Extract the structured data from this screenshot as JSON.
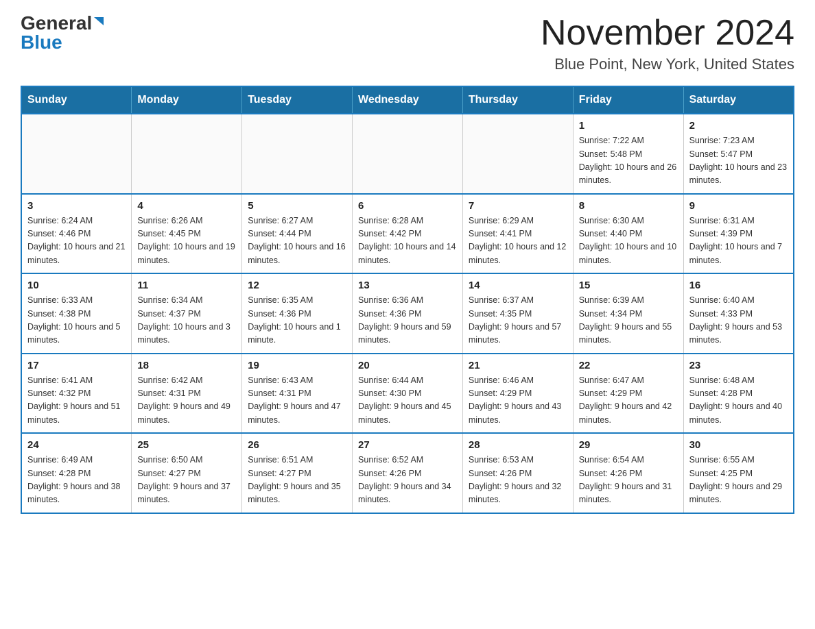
{
  "header": {
    "logo_general": "General",
    "logo_blue": "Blue",
    "title": "November 2024",
    "subtitle": "Blue Point, New York, United States"
  },
  "weekdays": [
    "Sunday",
    "Monday",
    "Tuesday",
    "Wednesday",
    "Thursday",
    "Friday",
    "Saturday"
  ],
  "weeks": [
    [
      {
        "day": "",
        "info": ""
      },
      {
        "day": "",
        "info": ""
      },
      {
        "day": "",
        "info": ""
      },
      {
        "day": "",
        "info": ""
      },
      {
        "day": "",
        "info": ""
      },
      {
        "day": "1",
        "info": "Sunrise: 7:22 AM\nSunset: 5:48 PM\nDaylight: 10 hours and 26 minutes."
      },
      {
        "day": "2",
        "info": "Sunrise: 7:23 AM\nSunset: 5:47 PM\nDaylight: 10 hours and 23 minutes."
      }
    ],
    [
      {
        "day": "3",
        "info": "Sunrise: 6:24 AM\nSunset: 4:46 PM\nDaylight: 10 hours and 21 minutes."
      },
      {
        "day": "4",
        "info": "Sunrise: 6:26 AM\nSunset: 4:45 PM\nDaylight: 10 hours and 19 minutes."
      },
      {
        "day": "5",
        "info": "Sunrise: 6:27 AM\nSunset: 4:44 PM\nDaylight: 10 hours and 16 minutes."
      },
      {
        "day": "6",
        "info": "Sunrise: 6:28 AM\nSunset: 4:42 PM\nDaylight: 10 hours and 14 minutes."
      },
      {
        "day": "7",
        "info": "Sunrise: 6:29 AM\nSunset: 4:41 PM\nDaylight: 10 hours and 12 minutes."
      },
      {
        "day": "8",
        "info": "Sunrise: 6:30 AM\nSunset: 4:40 PM\nDaylight: 10 hours and 10 minutes."
      },
      {
        "day": "9",
        "info": "Sunrise: 6:31 AM\nSunset: 4:39 PM\nDaylight: 10 hours and 7 minutes."
      }
    ],
    [
      {
        "day": "10",
        "info": "Sunrise: 6:33 AM\nSunset: 4:38 PM\nDaylight: 10 hours and 5 minutes."
      },
      {
        "day": "11",
        "info": "Sunrise: 6:34 AM\nSunset: 4:37 PM\nDaylight: 10 hours and 3 minutes."
      },
      {
        "day": "12",
        "info": "Sunrise: 6:35 AM\nSunset: 4:36 PM\nDaylight: 10 hours and 1 minute."
      },
      {
        "day": "13",
        "info": "Sunrise: 6:36 AM\nSunset: 4:36 PM\nDaylight: 9 hours and 59 minutes."
      },
      {
        "day": "14",
        "info": "Sunrise: 6:37 AM\nSunset: 4:35 PM\nDaylight: 9 hours and 57 minutes."
      },
      {
        "day": "15",
        "info": "Sunrise: 6:39 AM\nSunset: 4:34 PM\nDaylight: 9 hours and 55 minutes."
      },
      {
        "day": "16",
        "info": "Sunrise: 6:40 AM\nSunset: 4:33 PM\nDaylight: 9 hours and 53 minutes."
      }
    ],
    [
      {
        "day": "17",
        "info": "Sunrise: 6:41 AM\nSunset: 4:32 PM\nDaylight: 9 hours and 51 minutes."
      },
      {
        "day": "18",
        "info": "Sunrise: 6:42 AM\nSunset: 4:31 PM\nDaylight: 9 hours and 49 minutes."
      },
      {
        "day": "19",
        "info": "Sunrise: 6:43 AM\nSunset: 4:31 PM\nDaylight: 9 hours and 47 minutes."
      },
      {
        "day": "20",
        "info": "Sunrise: 6:44 AM\nSunset: 4:30 PM\nDaylight: 9 hours and 45 minutes."
      },
      {
        "day": "21",
        "info": "Sunrise: 6:46 AM\nSunset: 4:29 PM\nDaylight: 9 hours and 43 minutes."
      },
      {
        "day": "22",
        "info": "Sunrise: 6:47 AM\nSunset: 4:29 PM\nDaylight: 9 hours and 42 minutes."
      },
      {
        "day": "23",
        "info": "Sunrise: 6:48 AM\nSunset: 4:28 PM\nDaylight: 9 hours and 40 minutes."
      }
    ],
    [
      {
        "day": "24",
        "info": "Sunrise: 6:49 AM\nSunset: 4:28 PM\nDaylight: 9 hours and 38 minutes."
      },
      {
        "day": "25",
        "info": "Sunrise: 6:50 AM\nSunset: 4:27 PM\nDaylight: 9 hours and 37 minutes."
      },
      {
        "day": "26",
        "info": "Sunrise: 6:51 AM\nSunset: 4:27 PM\nDaylight: 9 hours and 35 minutes."
      },
      {
        "day": "27",
        "info": "Sunrise: 6:52 AM\nSunset: 4:26 PM\nDaylight: 9 hours and 34 minutes."
      },
      {
        "day": "28",
        "info": "Sunrise: 6:53 AM\nSunset: 4:26 PM\nDaylight: 9 hours and 32 minutes."
      },
      {
        "day": "29",
        "info": "Sunrise: 6:54 AM\nSunset: 4:26 PM\nDaylight: 9 hours and 31 minutes."
      },
      {
        "day": "30",
        "info": "Sunrise: 6:55 AM\nSunset: 4:25 PM\nDaylight: 9 hours and 29 minutes."
      }
    ]
  ]
}
